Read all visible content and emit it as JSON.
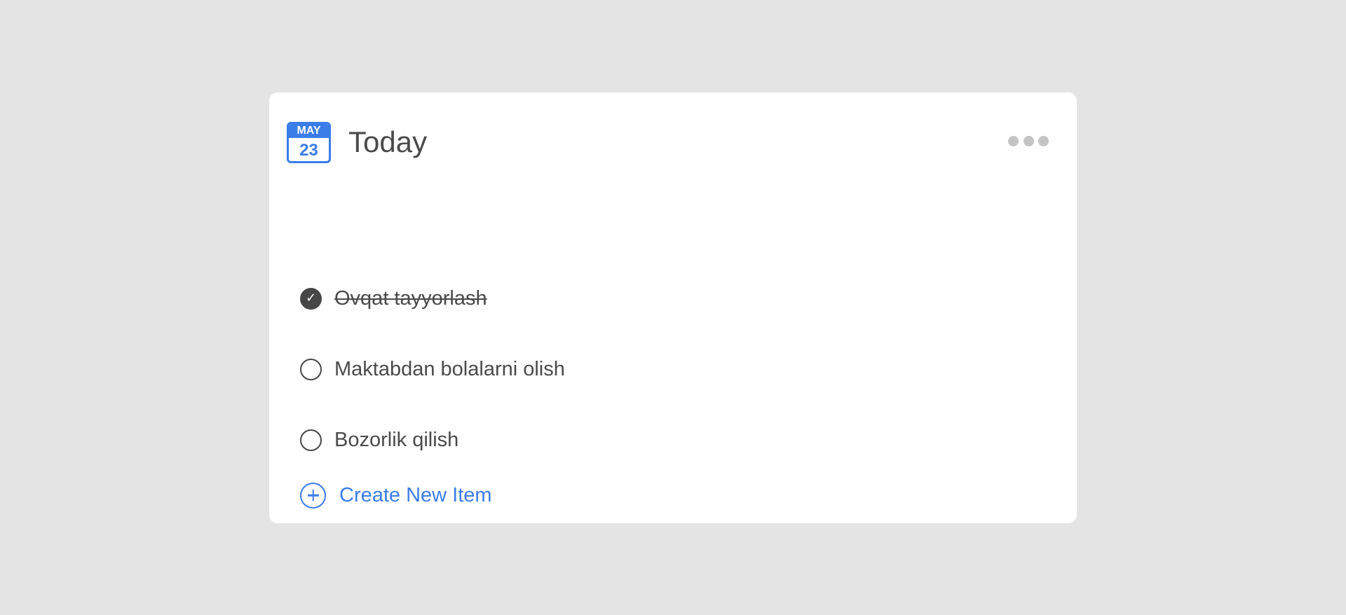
{
  "widget": {
    "calendar": {
      "month": "MAY",
      "day": "23"
    },
    "title": "Today",
    "more_icon": "more-horizontal-icon"
  },
  "tasks": [
    {
      "label": "Ovqat tayyorlash",
      "done": true
    },
    {
      "label": "Maktabdan bolalarni olish",
      "done": false
    },
    {
      "label": "Bozorlik qilish",
      "done": false
    }
  ],
  "create_button": {
    "label": "Create New Item",
    "icon": "plus-circle-icon"
  },
  "colors": {
    "accent": "#3b7de8",
    "text": "#4a4a4a",
    "checkbox": "#474747",
    "muted_dots": "#c4c4c4",
    "background": "#e4e4e4",
    "card": "#ffffff"
  }
}
